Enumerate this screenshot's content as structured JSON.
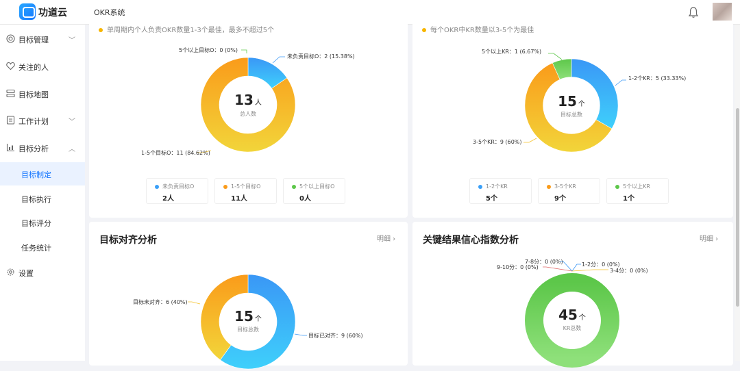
{
  "header": {
    "brand": "功道云",
    "system_title": "OKR系统"
  },
  "sidebar": {
    "items": [
      {
        "label": "目标管理",
        "icon": "target-icon",
        "has_arrow": true
      },
      {
        "label": "关注的人",
        "icon": "heart-icon",
        "has_arrow": false
      },
      {
        "label": "目标地图",
        "icon": "map-icon",
        "has_arrow": false
      },
      {
        "label": "工作计划",
        "icon": "plan-icon",
        "has_arrow": true
      },
      {
        "label": "目标分析",
        "icon": "chart-icon",
        "has_arrow": true,
        "expanded": true
      }
    ],
    "subitems": [
      {
        "label": "目标制定",
        "active": true
      },
      {
        "label": "目标执行"
      },
      {
        "label": "目标评分"
      },
      {
        "label": "任务统计"
      }
    ],
    "settings": {
      "label": "设置",
      "icon": "gear-icon"
    }
  },
  "cards": {
    "people": {
      "note": "单周期内个人负责OKR数量1-3个最佳，最多不超过5个"
    },
    "kr": {
      "note": "每个OKR中KR数量以3-5个为最佳"
    },
    "align": {
      "title": "目标对齐分析",
      "detail": "明细"
    },
    "confidence": {
      "title": "关键结果信心指数分析",
      "detail": "明细"
    }
  },
  "chart_data": [
    {
      "type": "pie",
      "center": {
        "value": "13",
        "unit": "人",
        "label": "总人数"
      },
      "categories": [
        "未负责目标O",
        "1-5个目标O",
        "5个以上目标O"
      ],
      "values": [
        2,
        11,
        0
      ],
      "callouts": [
        "未负责目标O：2 (15.38%)",
        "1-5个目标O：11 (84.62%)",
        "5个以上目标O：0 (0%)"
      ],
      "legend": [
        {
          "name": "未负责目标O",
          "value": "2人",
          "color": "#3aa0f8"
        },
        {
          "name": "1-5个目标O",
          "value": "11人",
          "color": "#fa9b1a"
        },
        {
          "name": "5个以上目标O",
          "value": "0人",
          "color": "#5dc74a"
        }
      ],
      "colors": [
        "#3aa0f8",
        "#f5c22a",
        "#5dc74a"
      ]
    },
    {
      "type": "pie",
      "center": {
        "value": "15",
        "unit": "个",
        "label": "目标总数"
      },
      "categories": [
        "1-2个KR",
        "3-5个KR",
        "5个以上KR"
      ],
      "values": [
        5,
        9,
        1
      ],
      "callouts": [
        "1-2个KR：5 (33.33%)",
        "3-5个KR：9 (60%)",
        "5个以上KR：1 (6.67%)"
      ],
      "legend": [
        {
          "name": "1-2个KR",
          "value": "5个",
          "color": "#3aa0f8"
        },
        {
          "name": "3-5个KR",
          "value": "9个",
          "color": "#fa9b1a"
        },
        {
          "name": "5个以上KR",
          "value": "1个",
          "color": "#5dc74a"
        }
      ],
      "colors": [
        "#3aa0f8",
        "#f5c22a",
        "#5dc74a"
      ]
    },
    {
      "type": "pie",
      "center": {
        "value": "15",
        "unit": "个",
        "label": "目标总数"
      },
      "categories": [
        "目标已对齐",
        "目标未对齐"
      ],
      "values": [
        9,
        6
      ],
      "callouts": [
        "目标已对齐：9 (60%)",
        "目标未对齐：6 (40%)"
      ],
      "colors": [
        "#3aa0f8",
        "#f5c22a"
      ]
    },
    {
      "type": "pie",
      "center": {
        "value": "45",
        "unit": "个",
        "label": "KR总数"
      },
      "categories": [
        "1-2分",
        "3-4分",
        "7-8分",
        "9-10分"
      ],
      "values": [
        0,
        0,
        0,
        0
      ],
      "callouts": [
        "1-2分：0 (0%)",
        "3-4分：0 (0%)",
        "7-8分：0 (0%)",
        "9-10分：0 (0%)"
      ],
      "colors": [
        "#5dc74a"
      ]
    }
  ]
}
